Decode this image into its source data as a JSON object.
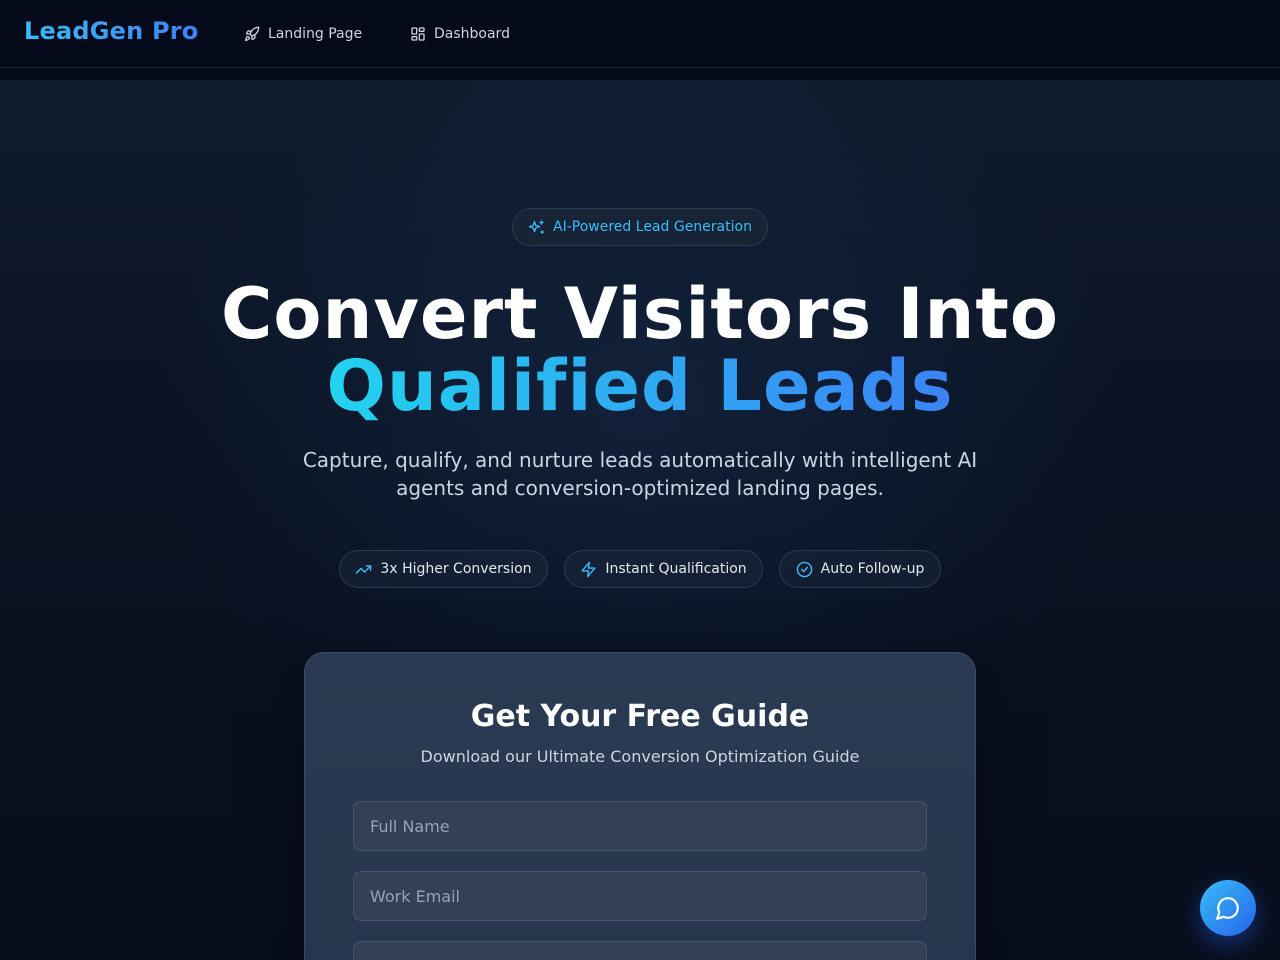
{
  "header": {
    "brand": "LeadGen Pro",
    "nav": [
      {
        "label": "Landing Page",
        "icon": "rocket-icon"
      },
      {
        "label": "Dashboard",
        "icon": "dashboard-grid-icon"
      }
    ]
  },
  "hero": {
    "badge": {
      "label": "AI-Powered Lead Generation",
      "icon": "sparkles-icon"
    },
    "title_line1": "Convert Visitors Into",
    "title_line2": "Qualified Leads",
    "subtitle": "Capture, qualify, and nurture leads automatically with intelligent AI agents and conversion-optimized landing pages.",
    "features": [
      {
        "label": "3x Higher Conversion",
        "icon": "trending-up-icon"
      },
      {
        "label": "Instant Qualification",
        "icon": "lightning-icon"
      },
      {
        "label": "Auto Follow-up",
        "icon": "check-circle-icon"
      }
    ]
  },
  "form": {
    "title": "Get Your Free Guide",
    "subtitle": "Download our Ultimate Conversion Optimization Guide",
    "fields": [
      {
        "placeholder": "Full Name",
        "value": ""
      },
      {
        "placeholder": "Work Email",
        "value": ""
      },
      {
        "placeholder": "",
        "value": ""
      }
    ]
  },
  "chat": {
    "icon": "chat-bubble-icon"
  },
  "colors": {
    "accent": "#38bdf8",
    "accent_gradient_end": "#3b82f6",
    "background": "#060b19"
  }
}
